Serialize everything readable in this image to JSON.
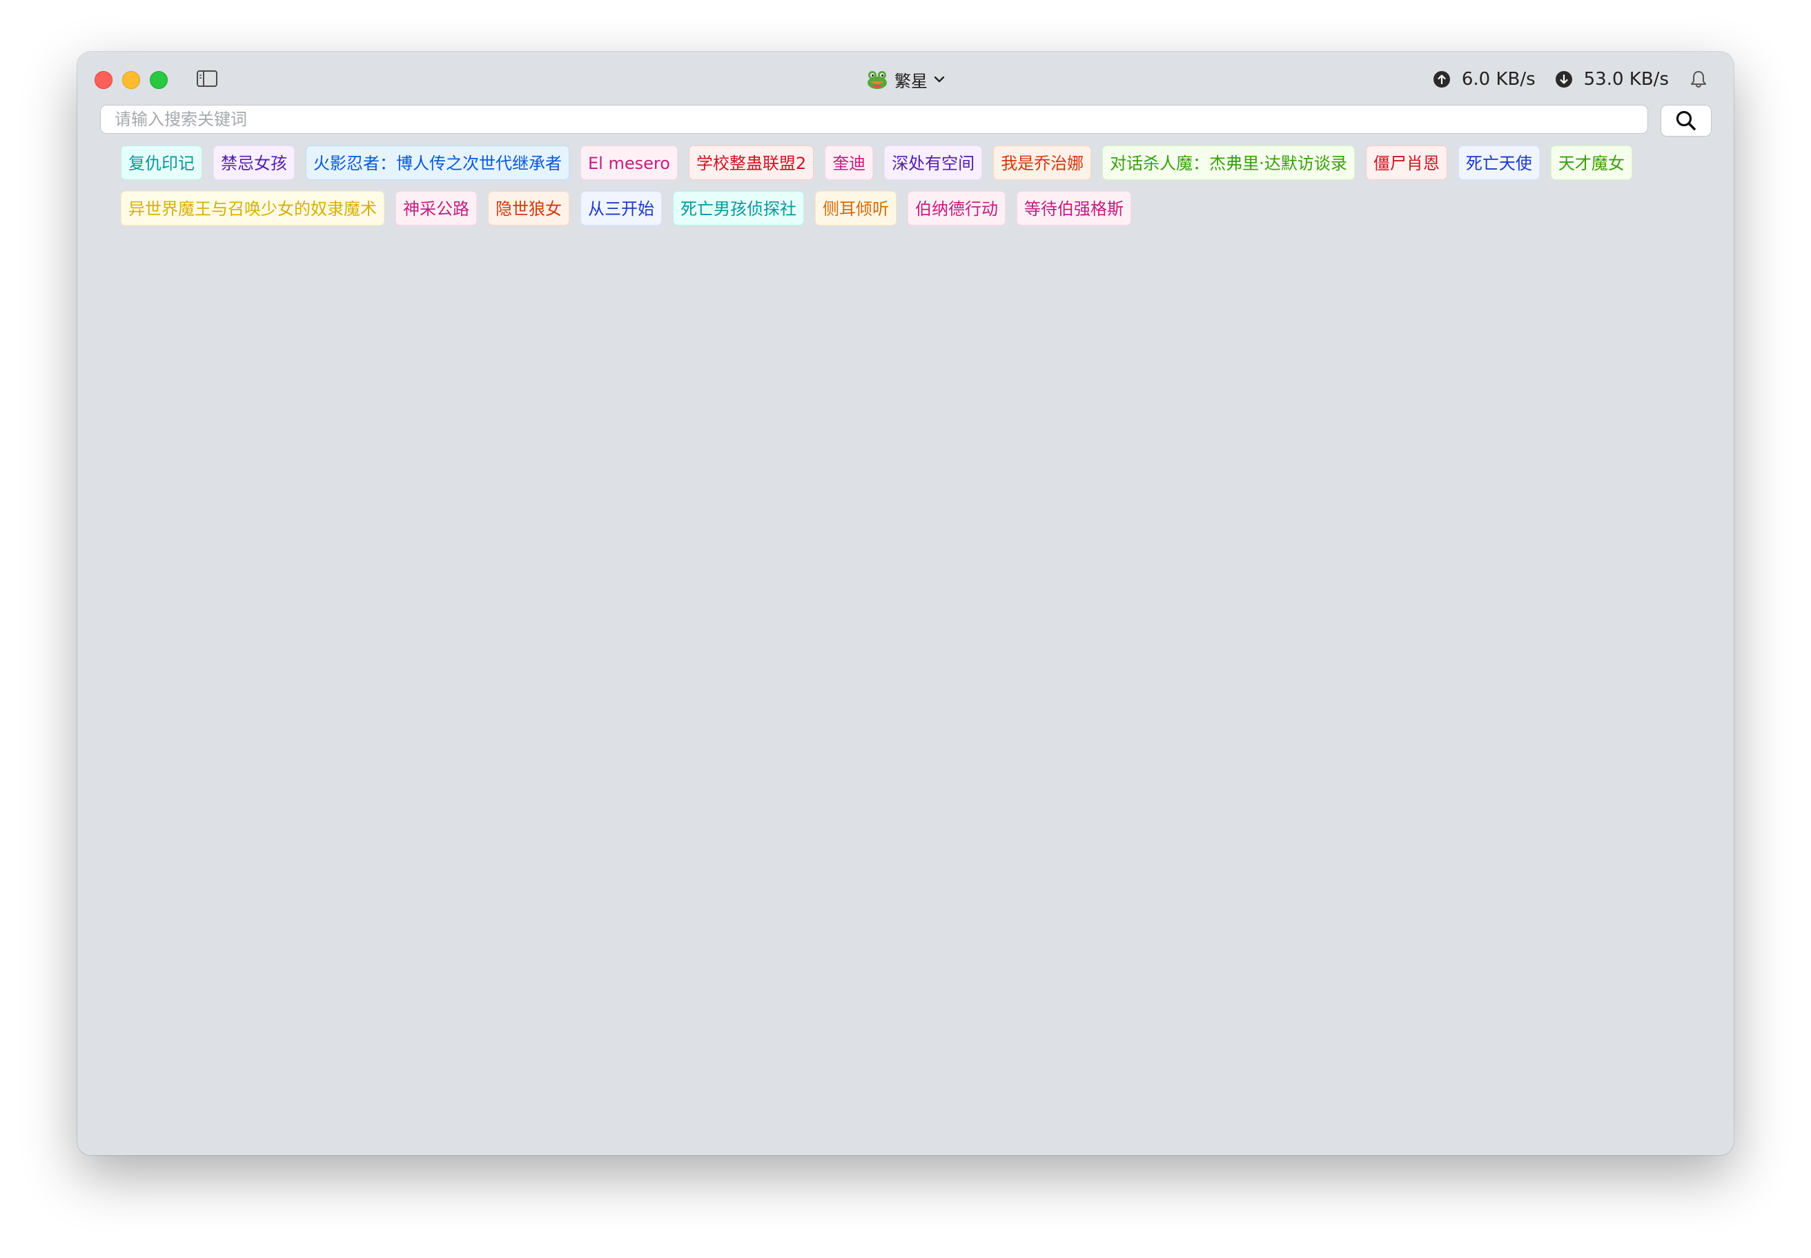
{
  "window": {
    "app_name": "繁星",
    "app_logo_icon": "frog-logo-icon",
    "upload_rate": "6.0 KB/s",
    "download_rate": "53.0 KB/s"
  },
  "search": {
    "placeholder": "请输入搜索关键词",
    "value": "",
    "button_icon": "search-icon"
  },
  "tags": [
    {
      "label": "复仇印记",
      "color": "cyan"
    },
    {
      "label": "禁忌女孩",
      "color": "purple"
    },
    {
      "label": "火影忍者：博人传之次世代继承者",
      "color": "blue"
    },
    {
      "label": "El mesero",
      "color": "magenta"
    },
    {
      "label": "学校整蛊联盟2",
      "color": "red"
    },
    {
      "label": "奎迪",
      "color": "magenta"
    },
    {
      "label": "深处有空间",
      "color": "purple"
    },
    {
      "label": "我是乔治娜",
      "color": "volcano"
    },
    {
      "label": "对话杀人魔：杰弗里·达默访谈录",
      "color": "green"
    },
    {
      "label": "僵尸肖恩",
      "color": "red"
    },
    {
      "label": "死亡天使",
      "color": "geekblue"
    },
    {
      "label": "天才魔女",
      "color": "green"
    },
    {
      "label": "异世界魔王与召唤少女的奴隶魔术",
      "color": "gold"
    },
    {
      "label": "神采公路",
      "color": "magenta"
    },
    {
      "label": "隐世狼女",
      "color": "volcano"
    },
    {
      "label": "从三开始",
      "color": "geekblue"
    },
    {
      "label": "死亡男孩侦探社",
      "color": "cyan"
    },
    {
      "label": "侧耳倾听",
      "color": "orange"
    },
    {
      "label": "伯纳德行动",
      "color": "magenta"
    },
    {
      "label": "等待伯强格斯",
      "color": "magenta"
    }
  ]
}
